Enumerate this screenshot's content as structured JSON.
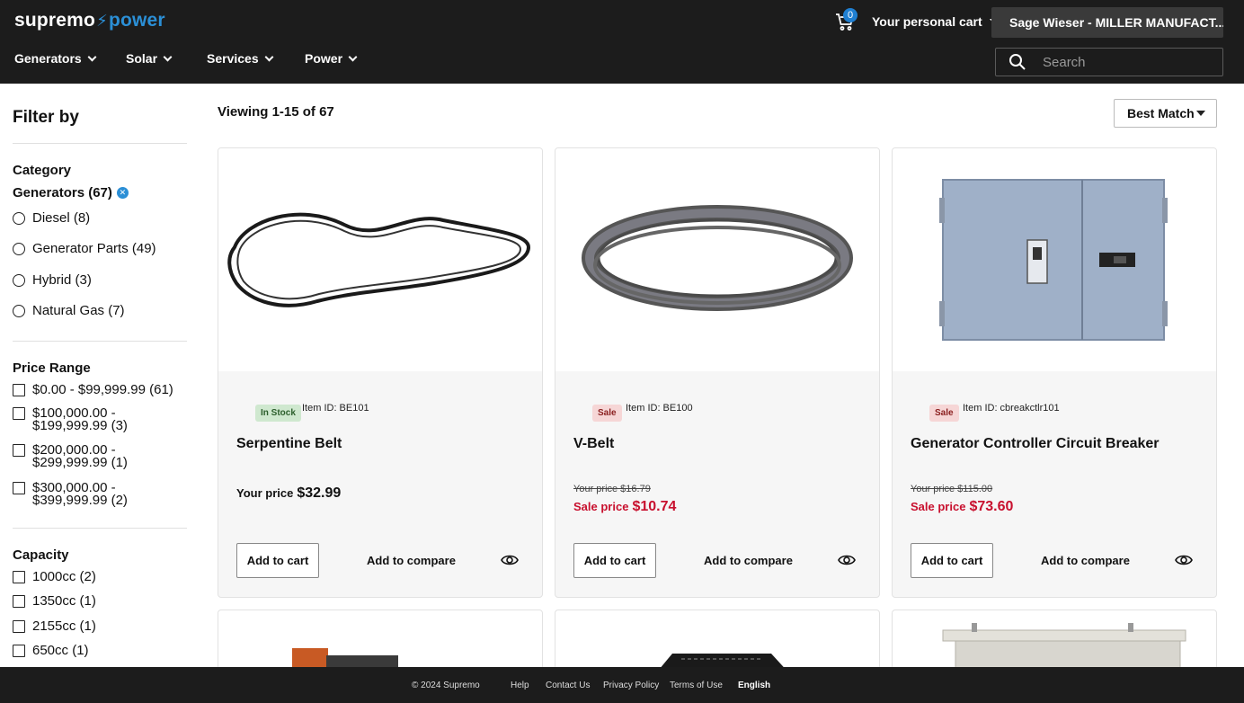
{
  "header": {
    "logo_main": "supremo",
    "logo_power": "power",
    "cart_count": "0",
    "cart_label": "Your personal cart",
    "account_label": "Sage Wieser - MILLER MANUFACT...",
    "search_placeholder": "Search",
    "nav": [
      "Generators",
      "Solar",
      "Services",
      "Power"
    ]
  },
  "sidebar": {
    "title": "Filter by",
    "category_title": "Category",
    "active_category": "Generators (67)",
    "category_options": [
      "Diesel (8)",
      "Generator Parts (49)",
      "Hybrid (3)",
      "Natural Gas (7)"
    ],
    "price_title": "Price Range",
    "price_options": [
      {
        "line1": "$0.00 - $99,999.99 (61)",
        "line2": ""
      },
      {
        "line1": "$100,000.00 -",
        "line2": "$199,999.99 (3)"
      },
      {
        "line1": "$200,000.00 -",
        "line2": "$299,999.99 (1)"
      },
      {
        "line1": "$300,000.00 -",
        "line2": "$399,999.99 (2)"
      }
    ],
    "capacity_title": "Capacity",
    "capacity_options": [
      "1000cc (2)",
      "1350cc (1)",
      "2155cc (1)",
      "650cc (1)"
    ]
  },
  "main": {
    "viewing": "Viewing 1-15 of 67",
    "sort_label": "Best Match",
    "add_to_cart": "Add to cart",
    "add_to_compare": "Add to compare",
    "your_price_label": "Your price",
    "sale_price_label": "Sale price",
    "products": [
      {
        "badge": "In Stock",
        "item_id": "Item ID: BE101",
        "name": "Serpentine Belt",
        "price": "$32.99"
      },
      {
        "badge": "Sale",
        "item_id": "Item ID: BE100",
        "name": "V-Belt",
        "old_price": "Your price $16.79",
        "sale_price": "$10.74"
      },
      {
        "badge": "Sale",
        "item_id": "Item ID: cbreakctlr101",
        "name": "Generator Controller Circuit Breaker",
        "old_price": "Your price $115.00",
        "sale_price": "$73.60"
      }
    ]
  },
  "footer": {
    "copyright": "© 2024 Supremo",
    "links": [
      "Help",
      "Contact Us",
      "Privacy Policy",
      "Terms of Use",
      "English"
    ]
  },
  "colors": {
    "brand_blue": "#2b8fd6",
    "sale_red": "#c8102e",
    "header_bg": "#1c1c1c"
  }
}
